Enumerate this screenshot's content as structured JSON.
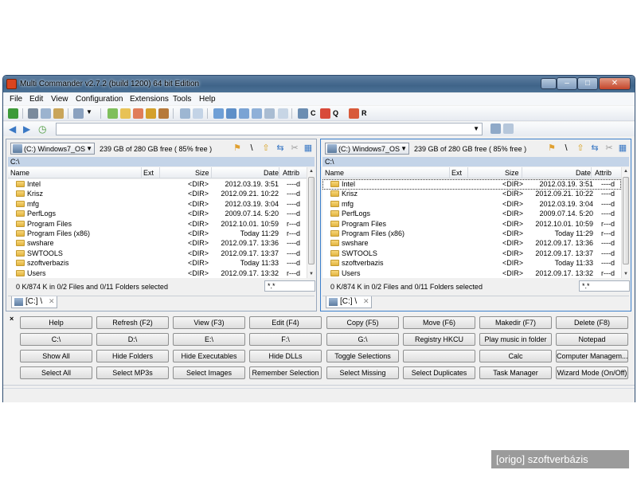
{
  "window": {
    "title": "Multi Commander v2.7.2 (build 1200) 64 bit Edition"
  },
  "menu": [
    "File",
    "Edit",
    "View",
    "Configuration",
    "Extensions",
    "Tools",
    "Help"
  ],
  "toolbar": {
    "c_label": "C",
    "q_label": "Q",
    "r_label": "R"
  },
  "left": {
    "drive": "(C:) Windows7_OS",
    "free": "239 GB of 280 GB free ( 85% free )",
    "path": "C:\\",
    "columns": {
      "name": "Name",
      "ext": "Ext",
      "size": "Size",
      "date": "Date",
      "attrib": "Attrib"
    },
    "rows": [
      {
        "name": "Intel",
        "size": "<DIR>",
        "date": "2012.03.19. 3:51",
        "attr": "----d"
      },
      {
        "name": "Krisz",
        "size": "<DIR>",
        "date": "2012.09.21. 10:22",
        "attr": "----d"
      },
      {
        "name": "mfg",
        "size": "<DIR>",
        "date": "2012.03.19. 3:04",
        "attr": "----d"
      },
      {
        "name": "PerfLogs",
        "size": "<DIR>",
        "date": "2009.07.14. 5:20",
        "attr": "----d"
      },
      {
        "name": "Program Files",
        "size": "<DIR>",
        "date": "2012.10.01. 10:59",
        "attr": "r---d"
      },
      {
        "name": "Program Files (x86)",
        "size": "<DIR>",
        "date": "Today 11:29",
        "attr": "r---d"
      },
      {
        "name": "swshare",
        "size": "<DIR>",
        "date": "2012.09.17. 13:36",
        "attr": "----d"
      },
      {
        "name": "SWTOOLS",
        "size": "<DIR>",
        "date": "2012.09.17. 13:37",
        "attr": "----d"
      },
      {
        "name": "szoftverbazis",
        "size": "<DIR>",
        "date": "Today 11:33",
        "attr": "----d"
      },
      {
        "name": "Users",
        "size": "<DIR>",
        "date": "2012.09.17. 13:32",
        "attr": "r---d"
      }
    ],
    "status": "0 K/874 K in 0/2 Files and 0/11 Folders selected",
    "filter": "*.*",
    "tab": "[C:] \\"
  },
  "right": {
    "drive": "(C:) Windows7_OS",
    "free": "239 GB of 280 GB free ( 85% free )",
    "path": "C:\\",
    "columns": {
      "name": "Name",
      "ext": "Ext",
      "size": "Size",
      "date": "Date",
      "attrib": "Attrib"
    },
    "rows": [
      {
        "name": "Intel",
        "size": "<DIR>",
        "date": "2012.03.19. 3:51",
        "attr": "----d"
      },
      {
        "name": "Krisz",
        "size": "<DIR>",
        "date": "2012.09.21. 10:22",
        "attr": "----d"
      },
      {
        "name": "mfg",
        "size": "<DIR>",
        "date": "2012.03.19. 3:04",
        "attr": "----d"
      },
      {
        "name": "PerfLogs",
        "size": "<DIR>",
        "date": "2009.07.14. 5:20",
        "attr": "----d"
      },
      {
        "name": "Program Files",
        "size": "<DIR>",
        "date": "2012.10.01. 10:59",
        "attr": "r---d"
      },
      {
        "name": "Program Files (x86)",
        "size": "<DIR>",
        "date": "Today 11:29",
        "attr": "r---d"
      },
      {
        "name": "swshare",
        "size": "<DIR>",
        "date": "2012.09.17. 13:36",
        "attr": "----d"
      },
      {
        "name": "SWTOOLS",
        "size": "<DIR>",
        "date": "2012.09.17. 13:37",
        "attr": "----d"
      },
      {
        "name": "szoftverbazis",
        "size": "<DIR>",
        "date": "Today 11:33",
        "attr": "----d"
      },
      {
        "name": "Users",
        "size": "<DIR>",
        "date": "2012.09.17. 13:32",
        "attr": "r---d"
      }
    ],
    "status": "0 K/874 K in 0/2 Files and 0/11 Folders selected",
    "filter": "*.*",
    "tab": "[C:] \\"
  },
  "buttons": [
    [
      "Help",
      "Refresh (F2)",
      "View (F3)",
      "Edit (F4)",
      "Copy (F5)",
      "Move (F6)",
      "Makedir (F7)",
      "Delete (F8)"
    ],
    [
      "C:\\",
      "D:\\",
      "E:\\",
      "F:\\",
      "G:\\",
      "Registry HKCU",
      "Play music in folder",
      "Notepad"
    ],
    [
      "Show All",
      "Hide Folders",
      "Hide Executables",
      "Hide DLLs",
      "Toggle Selections",
      "",
      "Calc",
      "Computer Managem..."
    ],
    [
      "Select All",
      "Select MP3s",
      "Select Images",
      "Remember Selection",
      "Select Missing",
      "Select Duplicates",
      "Task Manager",
      "Wizard Mode (On/Off)"
    ]
  ],
  "watermark": "[origo] szoftverbázis"
}
